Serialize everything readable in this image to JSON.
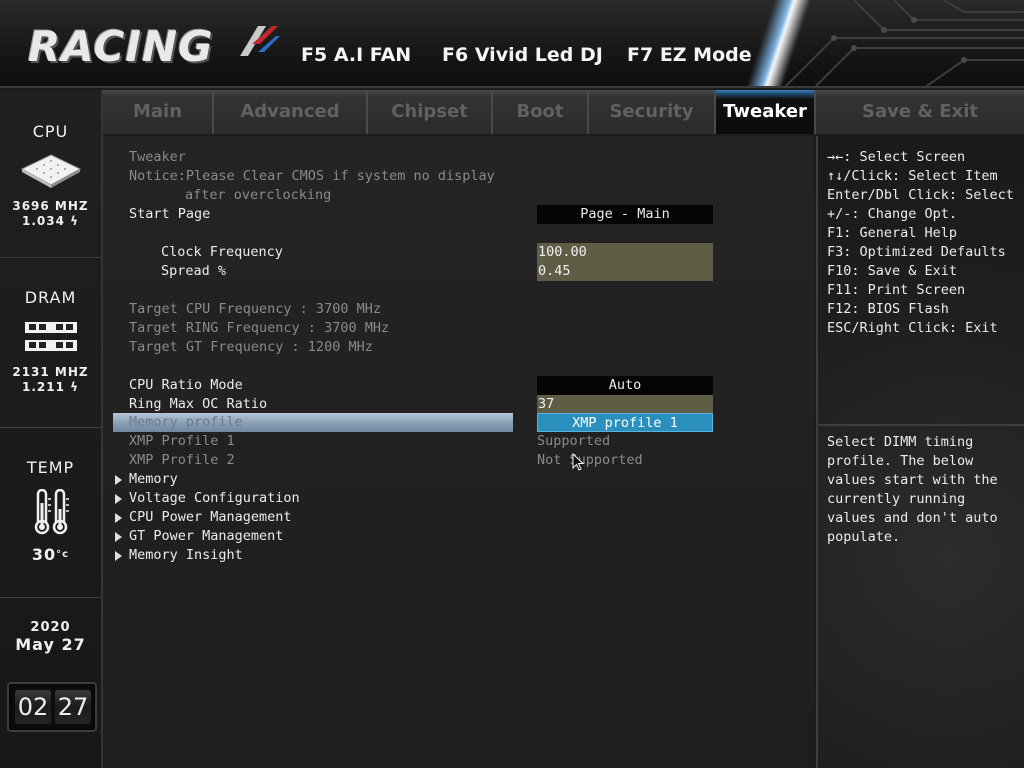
{
  "header": {
    "logo_text": "RACING",
    "fkeys": [
      "F5 A.I FAN",
      "F6 Vivid Led DJ",
      "F7 EZ Mode"
    ]
  },
  "sidebar": {
    "cpu": {
      "title": "CPU",
      "freq": "3696 MHZ",
      "volt": "1.034"
    },
    "dram": {
      "title": "DRAM",
      "freq": "2131 MHZ",
      "volt": "1.211"
    },
    "temp": {
      "title": "TEMP",
      "value": "30"
    },
    "date": {
      "year": "2020",
      "month_day": "May 27"
    },
    "time": {
      "hour": "02",
      "minute": "27"
    }
  },
  "tabs": [
    {
      "label": "Main",
      "active": false
    },
    {
      "label": "Advanced",
      "active": false
    },
    {
      "label": "Chipset",
      "active": false
    },
    {
      "label": "Boot",
      "active": false
    },
    {
      "label": "Security",
      "active": false
    },
    {
      "label": "Tweaker",
      "active": true
    },
    {
      "label": "Save & Exit",
      "active": false
    }
  ],
  "main": {
    "section_title": "Tweaker",
    "notice_line1": "Notice:Please Clear CMOS if system no display",
    "notice_line2": "after overclocking",
    "start_page": {
      "label": "Start Page",
      "value": "Page - Main"
    },
    "clock_frequency": {
      "label": "Clock Frequency",
      "value": "100.00"
    },
    "spread": {
      "label": "Spread %",
      "value": "0.45"
    },
    "target_cpu": "Target CPU Frequency : 3700 MHz",
    "target_ring": "Target RING Frequency : 3700 MHz",
    "target_gt": "Target GT Frequency : 1200 MHz",
    "cpu_ratio_mode": {
      "label": "CPU Ratio Mode",
      "value": "Auto"
    },
    "ring_max_oc": {
      "label": "Ring Max OC Ratio",
      "value": "37"
    },
    "memory_profile": {
      "label": "Memory profile",
      "value": "XMP profile 1"
    },
    "xmp1": {
      "label": "XMP Profile 1",
      "value": "Supported"
    },
    "xmp2": {
      "label": "XMP Profile 2",
      "value": "Not Supported"
    },
    "submenus": [
      "Memory",
      "Voltage Configuration",
      "CPU Power Management",
      "GT Power Management",
      "Memory Insight"
    ]
  },
  "help": {
    "keys": [
      "→←: Select Screen",
      "↑↓/Click: Select Item",
      "Enter/Dbl Click: Select",
      "+/-: Change Opt.",
      "F1: General Help",
      "F3: Optimized Defaults",
      "F10: Save & Exit",
      "F11: Print Screen",
      "F12: BIOS Flash",
      "ESC/Right Click: Exit"
    ],
    "description": [
      "Select DIMM timing",
      "profile. The below",
      "values start with the",
      "currently running",
      "values and don't auto",
      "populate."
    ]
  },
  "colors": {
    "selected_value": "#2b8fbd",
    "editable_value": "#5f5d45",
    "selected_row": "#8aa1b7"
  }
}
